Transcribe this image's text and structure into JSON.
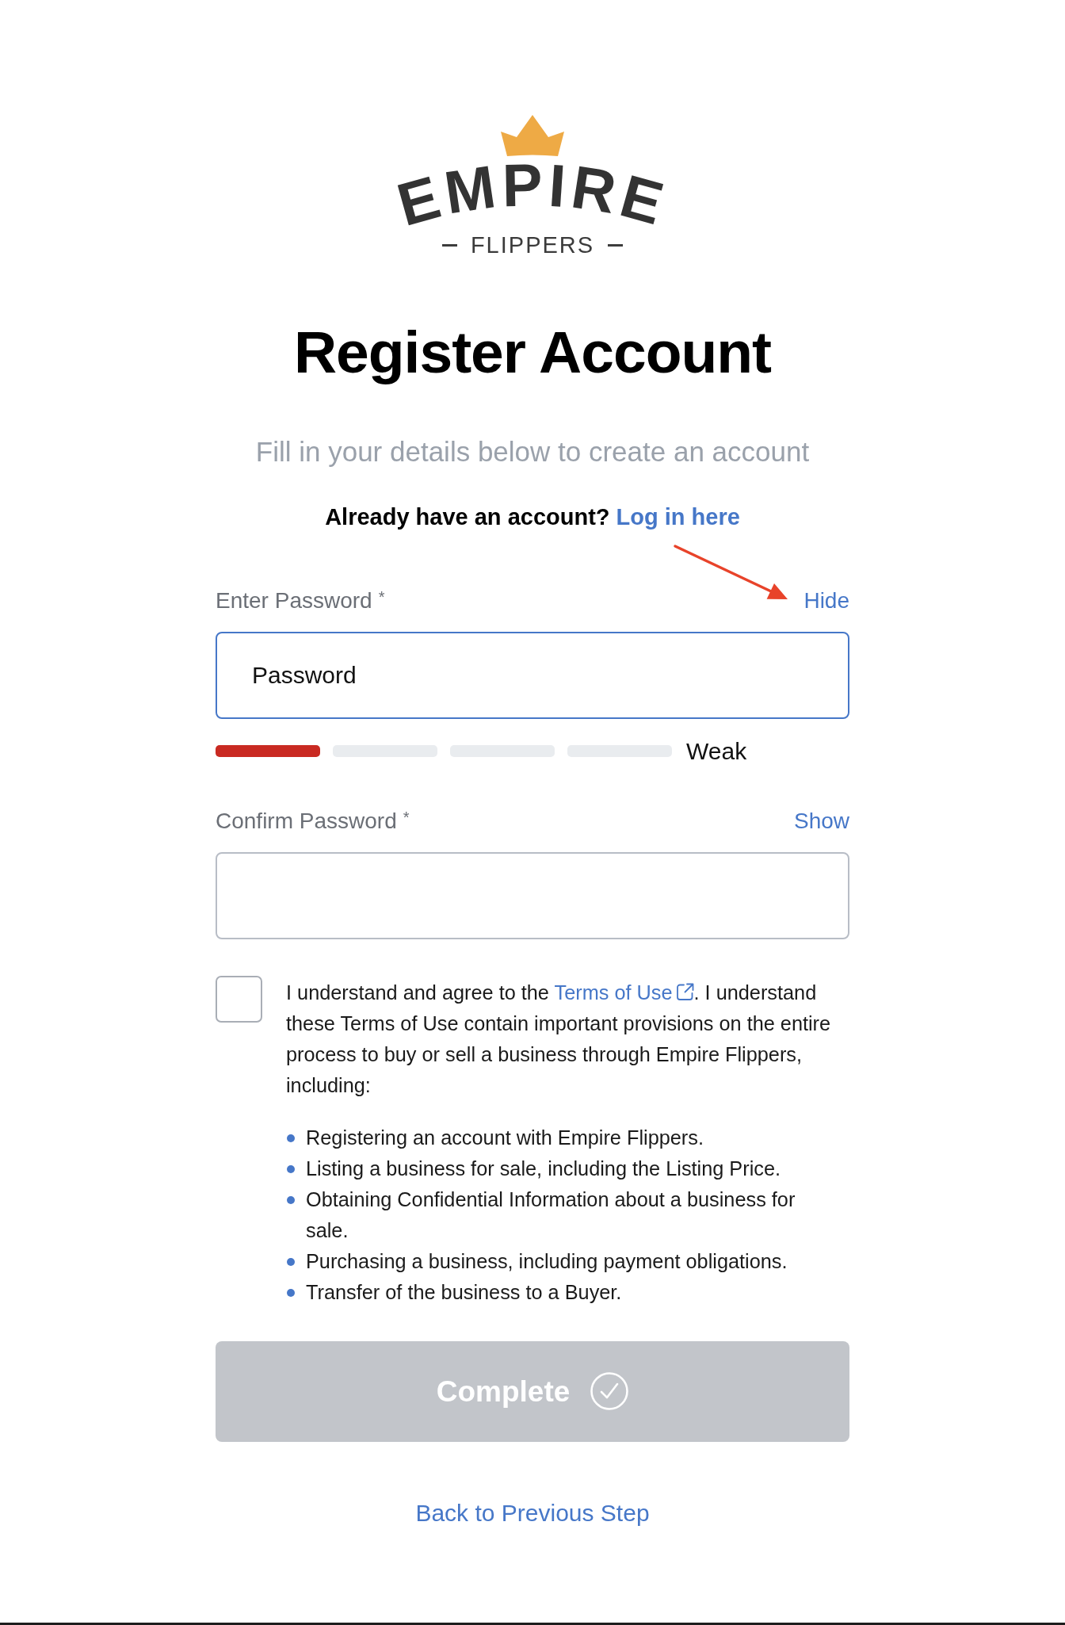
{
  "logo": {
    "wordmark": "EMPIRE",
    "tagline": "FLIPPERS"
  },
  "title": "Register Account",
  "subtitle": "Fill in your details below to create an account",
  "login_prompt": {
    "text": "Already have an account?",
    "link": "Log in here"
  },
  "fields": [
    {
      "label": "Enter Password",
      "required_mark": "*",
      "toggle": "Hide",
      "value": "Password",
      "focused": true,
      "strength": {
        "segments": [
          {
            "filled": true
          },
          {
            "filled": false
          },
          {
            "filled": false
          },
          {
            "filled": false
          }
        ],
        "label": "Weak"
      }
    },
    {
      "label": "Confirm Password",
      "required_mark": "*",
      "toggle": "Show",
      "focused": false
    }
  ],
  "agreement": {
    "checked": false,
    "text_before": "I understand and agree to the ",
    "link": "Terms of Use",
    "text_after": ". I understand these Terms of Use contain important provisions on the entire process to buy or sell a business through Empire Flippers, including:",
    "items": [
      "Registering an account with Empire Flippers.",
      "Listing a business for sale, including the Listing Price.",
      "Obtaining Confidential Information about a business for sale.",
      "Purchasing a business, including payment obligations.",
      "Transfer of the business to a Buyer."
    ]
  },
  "submit": {
    "label": "Complete",
    "disabled": true
  },
  "back_link": "Back to Previous Step"
}
